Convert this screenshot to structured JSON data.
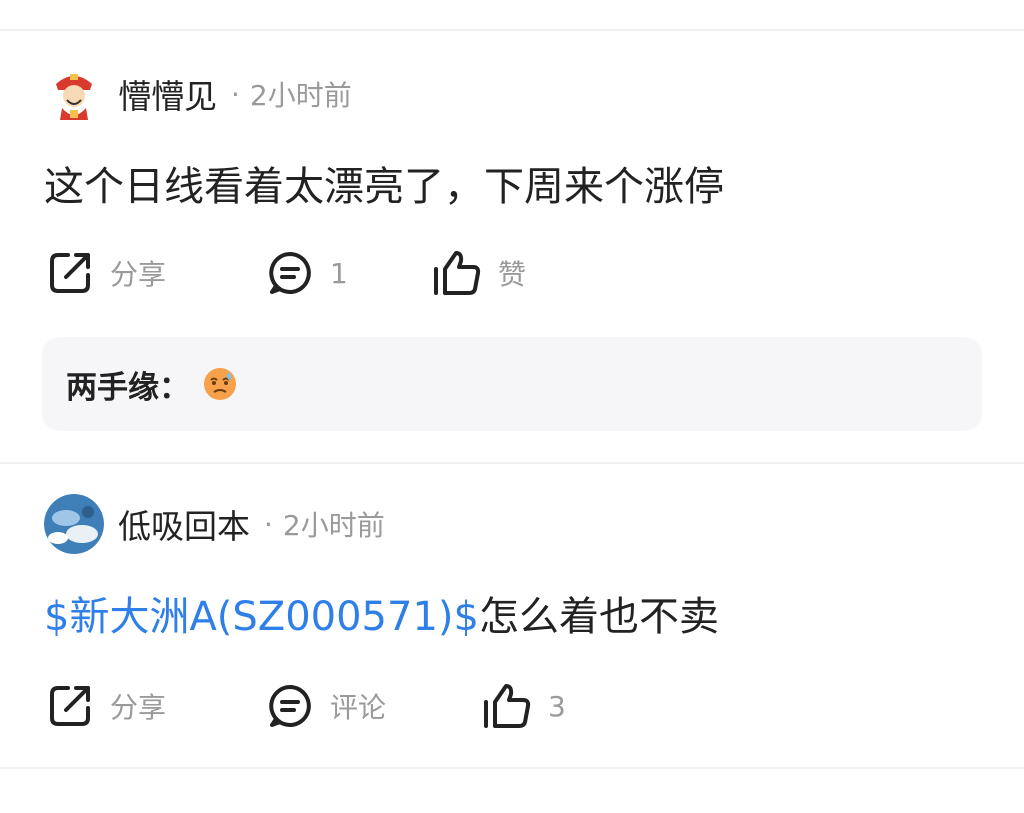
{
  "posts": [
    {
      "username": "懵懵见",
      "separator": "·",
      "time": "2小时前",
      "content_text": "这个日线看着太漂亮了，下周来个涨停",
      "actions": {
        "share_label": "分享",
        "comment_label": "1",
        "like_label": "赞"
      },
      "reply": {
        "name": "两手缘：",
        "emoji": "sweat-face-emoji"
      }
    },
    {
      "username": "低吸回本",
      "separator": "·",
      "time": "2小时前",
      "stock_link": "$新大洲A(SZ000571)$",
      "content_text": "怎么着也不卖",
      "actions": {
        "share_label": "分享",
        "comment_label": "评论",
        "like_label": "3"
      }
    }
  ],
  "colors": {
    "link": "#2f7fe8",
    "muted": "#9a9a9a",
    "text": "#222222",
    "reply_bg": "#f6f6f8"
  },
  "icons": [
    "share-icon",
    "comment-icon",
    "like-icon"
  ]
}
